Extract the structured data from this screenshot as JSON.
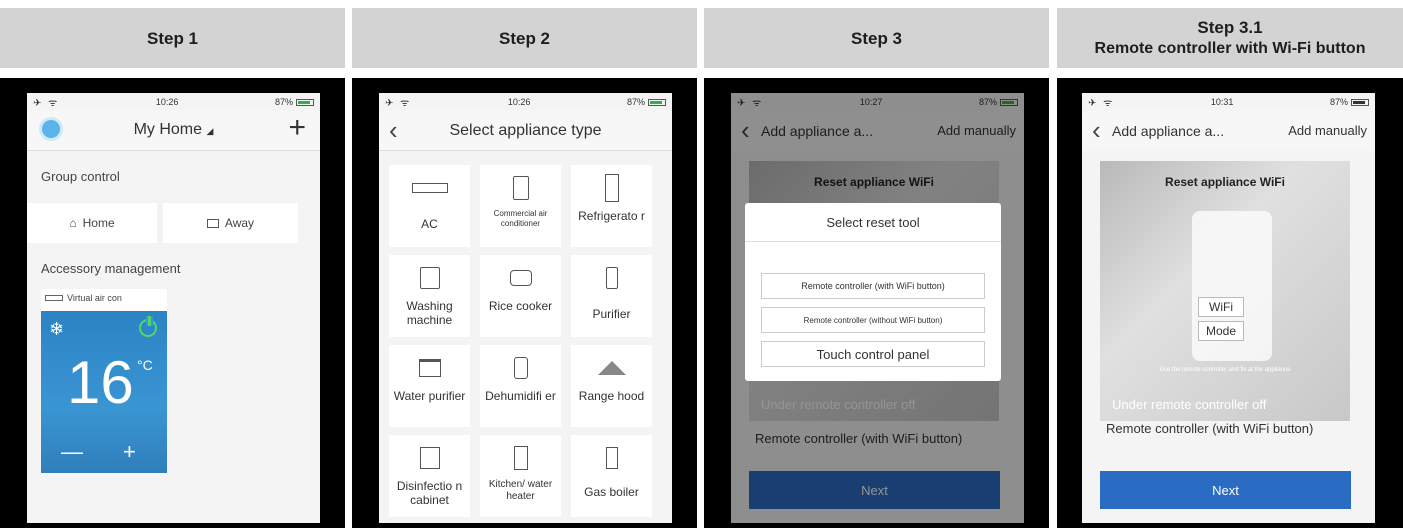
{
  "steps": [
    {
      "label": "Step 1"
    },
    {
      "label": "Step 2"
    },
    {
      "label": "Step 3"
    },
    {
      "label": "Step 3.1",
      "subtitle": "Remote controller with Wi-Fi button"
    }
  ],
  "status": {
    "signal": "✈ ᯤ",
    "battery_pct": "87%",
    "time_1": "10:26",
    "time_2": "10:26",
    "time_3": "10:27",
    "time_4": "10:31",
    "battery_pct_4": "87%"
  },
  "screen1": {
    "title": "My Home",
    "group_control": "Group control",
    "home_btn": "Home",
    "away_btn": "Away",
    "accessory_management": "Accessory management",
    "device_name": "Virtual air con",
    "temperature": "16",
    "unit": "°C",
    "minus": "—",
    "plus": "+"
  },
  "screen2": {
    "title": "Select appliance type",
    "tiles": [
      {
        "label": "AC",
        "icon": "ac-icon"
      },
      {
        "label": "Commercial air conditioner",
        "icon": "commercial-ac-icon"
      },
      {
        "label": "Refrigerato r",
        "icon": "refrigerator-icon"
      },
      {
        "label": "Washing machine",
        "icon": "washing-machine-icon"
      },
      {
        "label": "Rice cooker",
        "icon": "rice-cooker-icon"
      },
      {
        "label": "Purifier",
        "icon": "purifier-icon"
      },
      {
        "label": "Water purifier",
        "icon": "water-purifier-icon"
      },
      {
        "label": "Dehumidifi er",
        "icon": "dehumidifier-icon"
      },
      {
        "label": "Range hood",
        "icon": "range-hood-icon"
      },
      {
        "label": "Disinfectio n cabinet",
        "icon": "disinfection-cabinet-icon"
      },
      {
        "label": "Kitchen/ water heater",
        "icon": "water-heater-icon"
      },
      {
        "label": "Gas boiler",
        "icon": "gas-boiler-icon"
      }
    ]
  },
  "screen3": {
    "title": "Add appliance a...",
    "add_manually": "Add manually",
    "hero_title": "Reset appliance WiFi",
    "under_text": "Under remote controller off",
    "remote_text": "Remote controller (with WiFi button)",
    "next": "Next",
    "modal": {
      "title": "Select reset tool",
      "option_1": "Remote controller (with WiFi button)",
      "option_2": "Remote controller (without WiFi button)",
      "option_3": "Touch control panel"
    }
  },
  "screen4": {
    "title": "Add appliance a...",
    "add_manually": "Add manually",
    "hero_title": "Reset appliance WiFi",
    "wifi_btn": "WiFi",
    "mode_btn": "Mode",
    "caption": "Use the remote controller and fix at the appliance",
    "under_text": "Under remote controller off",
    "remote_text": "Remote controller (with WiFi button)",
    "next": "Next"
  },
  "colors": {
    "header_bg": "#d3d3d3",
    "ac_tile": "#3a95d3",
    "power_green": "#4cd964",
    "next_blue": "#2a6bc4"
  }
}
